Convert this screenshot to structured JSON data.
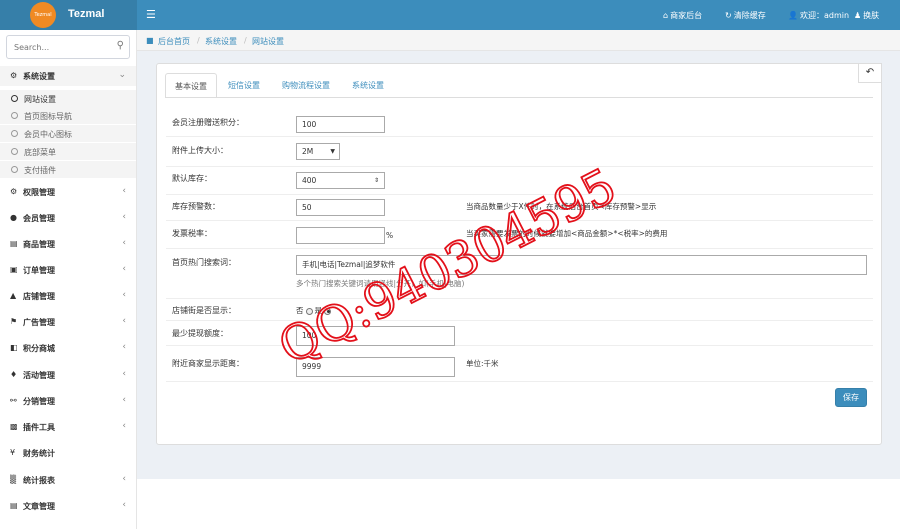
{
  "brand": {
    "name": "Tezmal",
    "logo_text": "Tezmal"
  },
  "topnav": {
    "merchant": "商家后台",
    "clear_cache": "清除缓存",
    "welcome": "欢迎：admin",
    "skin": "换肤"
  },
  "search": {
    "placeholder": "Search..."
  },
  "sidebar": {
    "groups": [
      {
        "label": "系统设置",
        "icon": "gear-icon",
        "expanded": true
      },
      {
        "label": "权限管理",
        "icon": "gears-icon"
      },
      {
        "label": "会员管理",
        "icon": "user-icon"
      },
      {
        "label": "商品管理",
        "icon": "list-icon"
      },
      {
        "label": "订单管理",
        "icon": "order-icon"
      },
      {
        "label": "店铺管理",
        "icon": "shop-icon"
      },
      {
        "label": "广告管理",
        "icon": "flag-icon"
      },
      {
        "label": "积分商城",
        "icon": "copy-icon"
      },
      {
        "label": "活动管理",
        "icon": "bell-icon"
      },
      {
        "label": "分销管理",
        "icon": "sitemap-icon"
      },
      {
        "label": "插件工具",
        "icon": "puzzle-icon"
      },
      {
        "label": "财务统计",
        "icon": "money-icon"
      },
      {
        "label": "统计报表",
        "icon": "chart-icon"
      },
      {
        "label": "文章管理",
        "icon": "file-icon"
      }
    ],
    "sub_items": [
      "网站设置",
      "首页图标导航",
      "会员中心图标",
      "底部菜单",
      "支付插件"
    ]
  },
  "breadcrumb": {
    "home": "后台首页",
    "level1": "系统设置",
    "level2": "网站设置"
  },
  "tabs": [
    "基本设置",
    "短信设置",
    "购物流程设置",
    "系统设置"
  ],
  "form": {
    "register_points": {
      "label": "会员注册赠送积分：",
      "value": "100"
    },
    "upload_size": {
      "label": "附件上传大小：",
      "value": "2M"
    },
    "default_stock": {
      "label": "默认库存：",
      "value": "400"
    },
    "stock_warning": {
      "label": "库存预警数：",
      "value": "50",
      "hint": "当商品数量少于X件时，在系统后台首页<库存预警>显示"
    },
    "invoice_tax": {
      "label": "发票税率：",
      "value": "",
      "unit": "%",
      "hint": "当买家需要发票的时候就要增加<商品金额>*<税率>的费用"
    },
    "hot_search": {
      "label": "首页热门搜索词：",
      "value": "手机|电话|Tezmal|追梦软件",
      "hint": "多个热门搜索关键词请用竖线|分开，如(手机|电脑)"
    },
    "street_show": {
      "label": "店铺街是否显示：",
      "no": "否",
      "yes": "是"
    },
    "min_withdraw": {
      "label": "最少提现额度：",
      "value": "100"
    },
    "nearby_distance": {
      "label": "附近商家显示距离：",
      "value": "9999",
      "hint": "单位:千米"
    }
  },
  "save_label": "保存",
  "watermark": "QQ:940304595",
  "colors": {
    "topbar": "#3c8dbc",
    "logo_bg": "#367fa9",
    "watermark": "#e3101a",
    "content_bg": "#ecf0f5"
  }
}
